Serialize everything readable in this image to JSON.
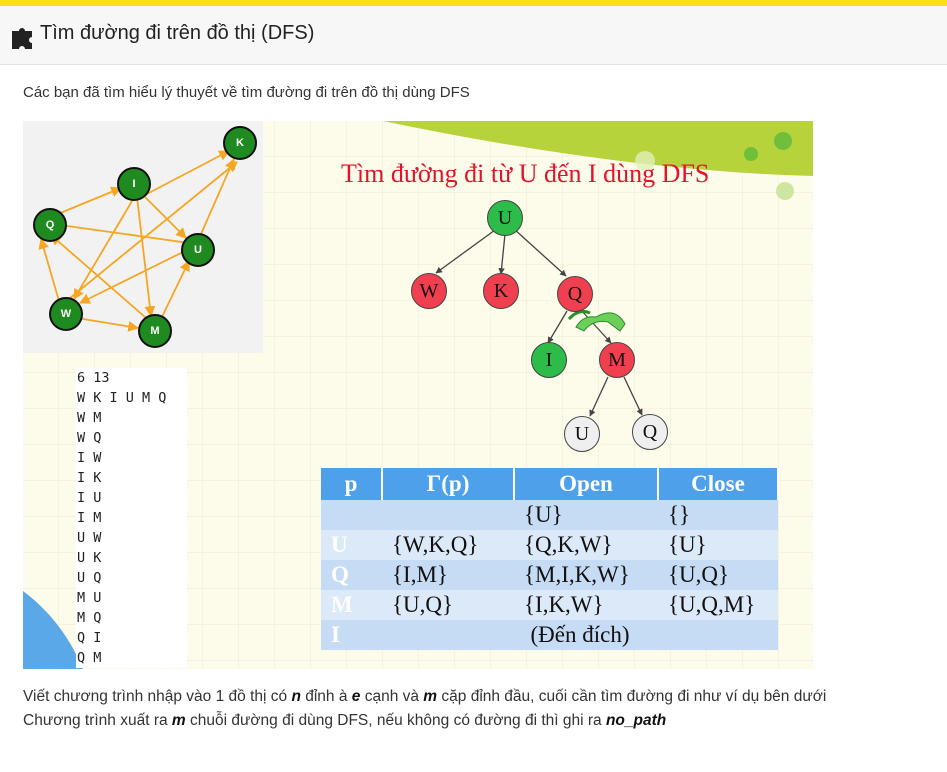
{
  "header": {
    "title": "Tìm đường đi trên đồ thị (DFS)",
    "icon": "puzzle-icon"
  },
  "intro": "Các bạn đã tìm hiểu lý thuyết về tìm đường đi trên đồ thị dùng DFS",
  "figure": {
    "graph_nodes": [
      "K",
      "I",
      "Q",
      "U",
      "W",
      "M"
    ],
    "input_lines": [
      "6 13",
      "W K I U M Q",
      "W M",
      "W Q",
      "I W",
      "I K",
      "I U",
      "I M",
      "U W",
      "U K",
      "U Q",
      "M U",
      "M Q",
      "Q I",
      "Q M"
    ],
    "title": "Tìm đường đi từ U đến I dùng DFS",
    "tree_nodes": {
      "root": "U",
      "w": "W",
      "k": "K",
      "q": "Q",
      "i": "I",
      "m": "M",
      "u2": "U",
      "q2": "Q"
    },
    "table": {
      "headers": [
        "p",
        "Γ(p)",
        "Open",
        "Close"
      ],
      "rows": [
        [
          "",
          "",
          "{U}",
          "{}"
        ],
        [
          "U",
          "{W,K,Q}",
          "{Q,K,W}",
          "{U}"
        ],
        [
          "Q",
          "{I,M}",
          "{M,I,K,W}",
          "{U,Q}"
        ],
        [
          "M",
          "{U,Q}",
          "{I,K,W}",
          "{U,Q,M}"
        ],
        [
          "I",
          "(Đến đích)"
        ]
      ]
    }
  },
  "desc": {
    "line1": {
      "a": "Viết chương trình nhập vào 1 đồ thị có ",
      "n": "n",
      "b": " đỉnh à ",
      "e": "e",
      "c": " cạnh và ",
      "m": "m",
      "d": " cặp đỉnh đầu, cuối cần tìm đường đi như ví dụ bên dưới"
    },
    "line2": {
      "a": "Chương trình xuất ra ",
      "m": "m",
      "b": " chuỗi đường đi dùng DFS, nếu không có đường đi thì ghi ra ",
      "np": "no_path"
    }
  },
  "colors": {
    "accent_bar": "#f7e01a",
    "graph_node": "#1f8a1f",
    "edge": "#f5a623",
    "red_node": "#f04050",
    "table_header": "#4da0e9"
  }
}
